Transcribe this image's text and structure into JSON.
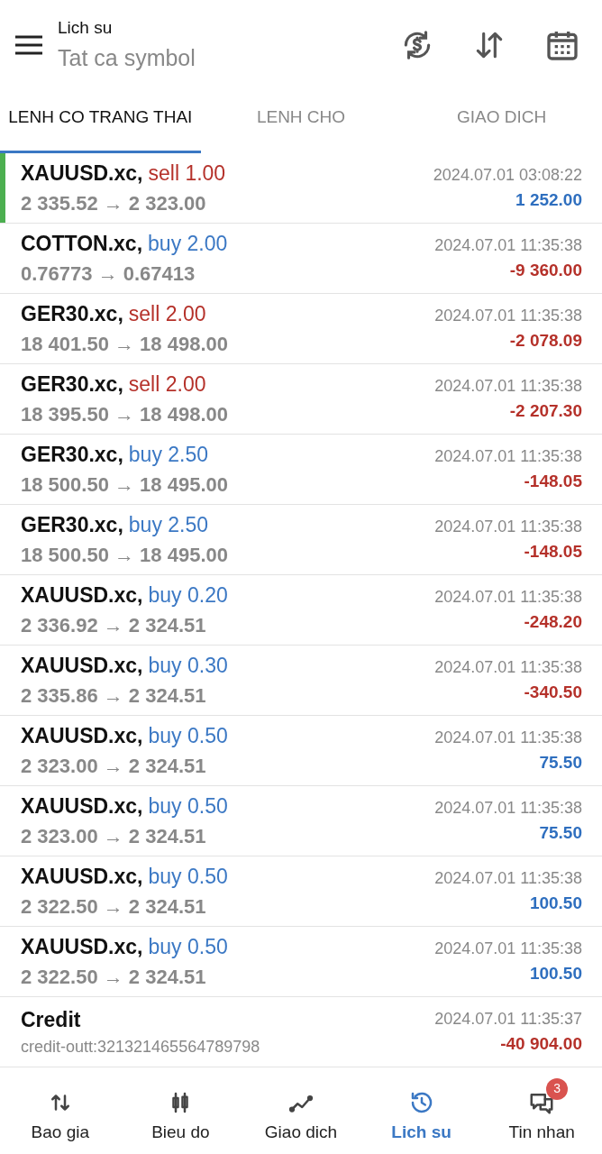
{
  "header": {
    "title": "Lich su",
    "subtitle": "Tat ca symbol"
  },
  "tabs": [
    {
      "label": "LENH CO TRANG THAI",
      "selected": true
    },
    {
      "label": "LENH CHO",
      "selected": false
    },
    {
      "label": "GIAO DICH",
      "selected": false
    }
  ],
  "rows": [
    {
      "kind": "trade",
      "selected": true,
      "symbol": "XAUUSD.xc,",
      "sell": true,
      "volume": "sell 1.00",
      "prices": "2 335.52 → 2 323.00",
      "time": "2024.07.01 03:08:22",
      "profit": "1 252.00",
      "loss": false
    },
    {
      "kind": "trade",
      "selected": false,
      "symbol": "COTTON.xc,",
      "sell": false,
      "volume": "buy 2.00",
      "prices": "0.76773 → 0.67413",
      "time": "2024.07.01 11:35:38",
      "profit": "-9 360.00",
      "loss": true
    },
    {
      "kind": "trade",
      "selected": false,
      "symbol": "GER30.xc,",
      "sell": true,
      "volume": "sell 2.00",
      "prices": "18 401.50 → 18 498.00",
      "time": "2024.07.01 11:35:38",
      "profit": "-2 078.09",
      "loss": true
    },
    {
      "kind": "trade",
      "selected": false,
      "symbol": "GER30.xc,",
      "sell": true,
      "volume": "sell 2.00",
      "prices": "18 395.50 → 18 498.00",
      "time": "2024.07.01 11:35:38",
      "profit": "-2 207.30",
      "loss": true
    },
    {
      "kind": "trade",
      "selected": false,
      "symbol": "GER30.xc,",
      "sell": false,
      "volume": "buy 2.50",
      "prices": "18 500.50 → 18 495.00",
      "time": "2024.07.01 11:35:38",
      "profit": "-148.05",
      "loss": true
    },
    {
      "kind": "trade",
      "selected": false,
      "symbol": "GER30.xc,",
      "sell": false,
      "volume": "buy 2.50",
      "prices": "18 500.50 → 18 495.00",
      "time": "2024.07.01 11:35:38",
      "profit": "-148.05",
      "loss": true
    },
    {
      "kind": "trade",
      "selected": false,
      "symbol": "XAUUSD.xc,",
      "sell": false,
      "volume": "buy 0.20",
      "prices": "2 336.92 → 2 324.51",
      "time": "2024.07.01 11:35:38",
      "profit": "-248.20",
      "loss": true
    },
    {
      "kind": "trade",
      "selected": false,
      "symbol": "XAUUSD.xc,",
      "sell": false,
      "volume": "buy 0.30",
      "prices": "2 335.86 → 2 324.51",
      "time": "2024.07.01 11:35:38",
      "profit": "-340.50",
      "loss": true
    },
    {
      "kind": "trade",
      "selected": false,
      "symbol": "XAUUSD.xc,",
      "sell": false,
      "volume": "buy 0.50",
      "prices": "2 323.00 → 2 324.51",
      "time": "2024.07.01 11:35:38",
      "profit": "75.50",
      "loss": false
    },
    {
      "kind": "trade",
      "selected": false,
      "symbol": "XAUUSD.xc,",
      "sell": false,
      "volume": "buy 0.50",
      "prices": "2 323.00 → 2 324.51",
      "time": "2024.07.01 11:35:38",
      "profit": "75.50",
      "loss": false
    },
    {
      "kind": "trade",
      "selected": false,
      "symbol": "XAUUSD.xc,",
      "sell": false,
      "volume": "buy 0.50",
      "prices": "2 322.50 → 2 324.51",
      "time": "2024.07.01 11:35:38",
      "profit": "100.50",
      "loss": false
    },
    {
      "kind": "trade",
      "selected": false,
      "symbol": "XAUUSD.xc,",
      "sell": false,
      "volume": "buy 0.50",
      "prices": "2 322.50 → 2 324.51",
      "time": "2024.07.01 11:35:38",
      "profit": "100.50",
      "loss": false
    },
    {
      "kind": "credit",
      "selected": false,
      "symbol": "Credit",
      "prices": "credit-outt:321321465564789798",
      "time": "2024.07.01 11:35:37",
      "profit": "-40 904.00",
      "loss": true
    }
  ],
  "bottom_nav": [
    {
      "label": "Bao gia",
      "selected": false
    },
    {
      "label": "Bieu do",
      "selected": false
    },
    {
      "label": "Giao dich",
      "selected": false
    },
    {
      "label": "Lich su",
      "selected": true
    },
    {
      "label": "Tin nhan",
      "selected": false,
      "badge": "3"
    }
  ]
}
